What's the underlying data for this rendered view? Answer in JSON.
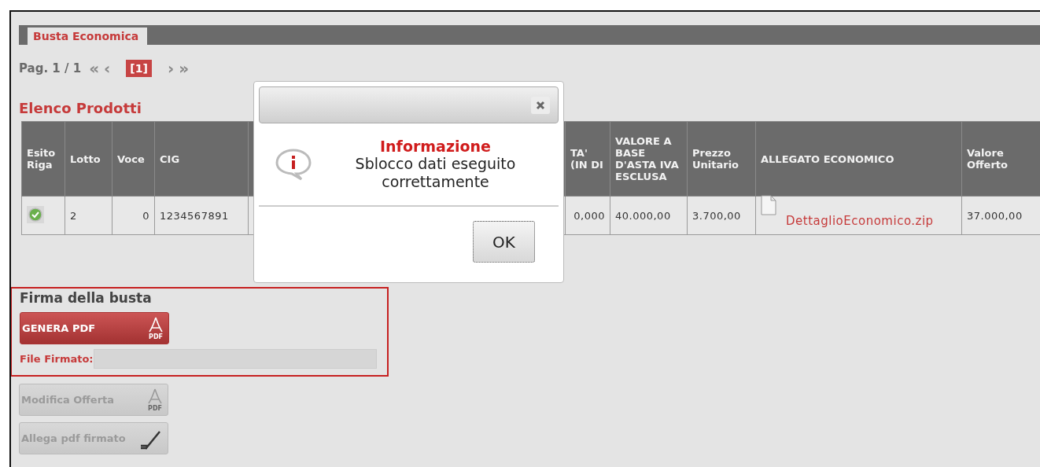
{
  "tabs": [
    {
      "label": "Busta Economica",
      "selected": true
    }
  ],
  "pagination": {
    "label": "Pag. 1 / 1",
    "first": "«",
    "prev": "‹",
    "pages": [
      {
        "label": "[1]",
        "selected": true
      }
    ],
    "next": "›",
    "last": "»"
  },
  "section_title": "Elenco Prodotti",
  "table": {
    "columns": [
      {
        "kind": "header",
        "label": "Esito Riga"
      },
      {
        "kind": "header",
        "label": "Lotto"
      },
      {
        "kind": "header",
        "label": "Voce"
      },
      {
        "kind": "header",
        "label": "CIG"
      },
      {
        "kind": "hidden"
      },
      {
        "kind": "header",
        "label": "TA' (IN DI"
      },
      {
        "kind": "header",
        "label": "VALORE A BASE D'ASTA IVA ESCLUSA"
      },
      {
        "kind": "header",
        "label": "Prezzo Unitario"
      },
      {
        "kind": "header",
        "label": "ALLEGATO ECONOMICO"
      },
      {
        "kind": "header",
        "label": "Valore Offerto"
      }
    ],
    "rows": [
      {
        "cells": [
          {
            "kind": "status",
            "ok": true
          },
          {
            "kind": "text",
            "text": "2"
          },
          {
            "kind": "text",
            "text": "0"
          },
          {
            "kind": "text",
            "text": "1234567891"
          },
          {
            "kind": "hidden"
          },
          {
            "kind": "text",
            "text": "0,000"
          },
          {
            "kind": "text",
            "text": "40.000,00"
          },
          {
            "kind": "text",
            "text": "3.700,00"
          },
          {
            "kind": "file",
            "text": "DettaglioEconomico.zip"
          },
          {
            "kind": "text",
            "text": "37.000,00"
          }
        ]
      }
    ]
  },
  "signature": {
    "title": "Firma della busta",
    "button": {
      "label": "GENERA PDF",
      "kind": "pdf",
      "badge": "PDF",
      "disabled": false
    },
    "file_label": "File Firmato:"
  },
  "actions": [
    {
      "label": "Modifica Offerta",
      "kind": "pdf",
      "badge": "PDF",
      "disabled": true
    },
    {
      "label": "Allega pdf firmato",
      "kind": "pen",
      "disabled": true
    }
  ],
  "dialog": {
    "title": "Informazione",
    "message": "Sblocco dati eseguito correttamente",
    "ok_button": "OK"
  }
}
